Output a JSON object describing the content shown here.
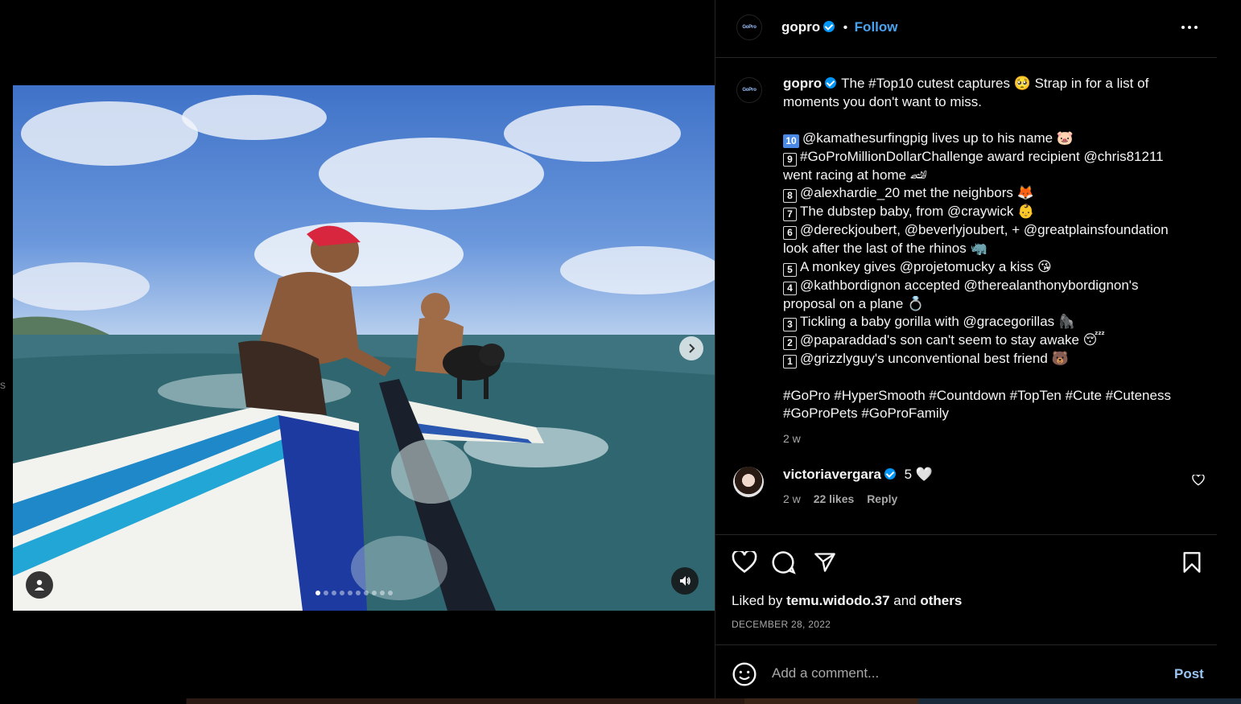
{
  "left_edge_char": "s",
  "post": {
    "author": "gopro",
    "logo_text": "GoPro",
    "follow_label": "Follow",
    "more_label": "More options",
    "dot_separator": "•"
  },
  "media": {
    "total_slides": 10,
    "active_slide": 1
  },
  "caption": {
    "author": "gopro",
    "lines": [
      {
        "num": "",
        "text": "The #Top10 cutest captures 🥺 Strap in for a list of"
      },
      {
        "num": "",
        "text": "moments you don't want to miss."
      },
      {
        "num": "",
        "text": ""
      },
      {
        "num": "10",
        "text": "@kamathesurfingpig lives up to his name 🐷"
      },
      {
        "num": "9",
        "text": "#GoProMillionDollarChallenge award recipient @chris81211"
      },
      {
        "num": "",
        "text": "went racing at home 🏎"
      },
      {
        "num": "8",
        "text": "@alexhardie_20 met the neighbors 🦊"
      },
      {
        "num": "7",
        "text": "The dubstep baby, from @craywick 👶"
      },
      {
        "num": "6",
        "text": "@dereckjoubert, @beverlyjoubert, + @greatplainsfoundation"
      },
      {
        "num": "",
        "text": "look after the last of the rhinos 🦏"
      },
      {
        "num": "5",
        "text": "A monkey gives @projetomucky a kiss 😘"
      },
      {
        "num": "4",
        "text": "@kathbordignon accepted @therealanthonybordignon's"
      },
      {
        "num": "",
        "text": "proposal on a plane 💍"
      },
      {
        "num": "3",
        "text": "Tickling a baby gorilla with @gracegorillas 🦍"
      },
      {
        "num": "2",
        "text": "@paparaddad's son can't seem to stay awake 😴"
      },
      {
        "num": "1",
        "text": "@grizzlyguy's unconventional best friend 🐻"
      },
      {
        "num": "",
        "text": ""
      },
      {
        "num": "",
        "text": "#GoPro #HyperSmooth #Countdown #TopTen #Cute #Cuteness"
      },
      {
        "num": "",
        "text": "#GoProPets #GoProFamily"
      }
    ],
    "time": "2 w"
  },
  "comment": {
    "user": "victoriavergara",
    "text": "5 🤍",
    "time": "2 w",
    "likes": "22 likes",
    "reply_label": "Reply"
  },
  "likes": {
    "prefix": "Liked by",
    "user": "temu.widodo.37",
    "and": "and",
    "others": "others"
  },
  "date": "DECEMBER 28, 2022",
  "add_comment": {
    "placeholder": "Add a comment...",
    "post_label": "Post"
  },
  "colors": {
    "background": "#000000",
    "accent": "#0095f6",
    "follow": "#4aa3f0",
    "muted": "#a8a8a8"
  }
}
